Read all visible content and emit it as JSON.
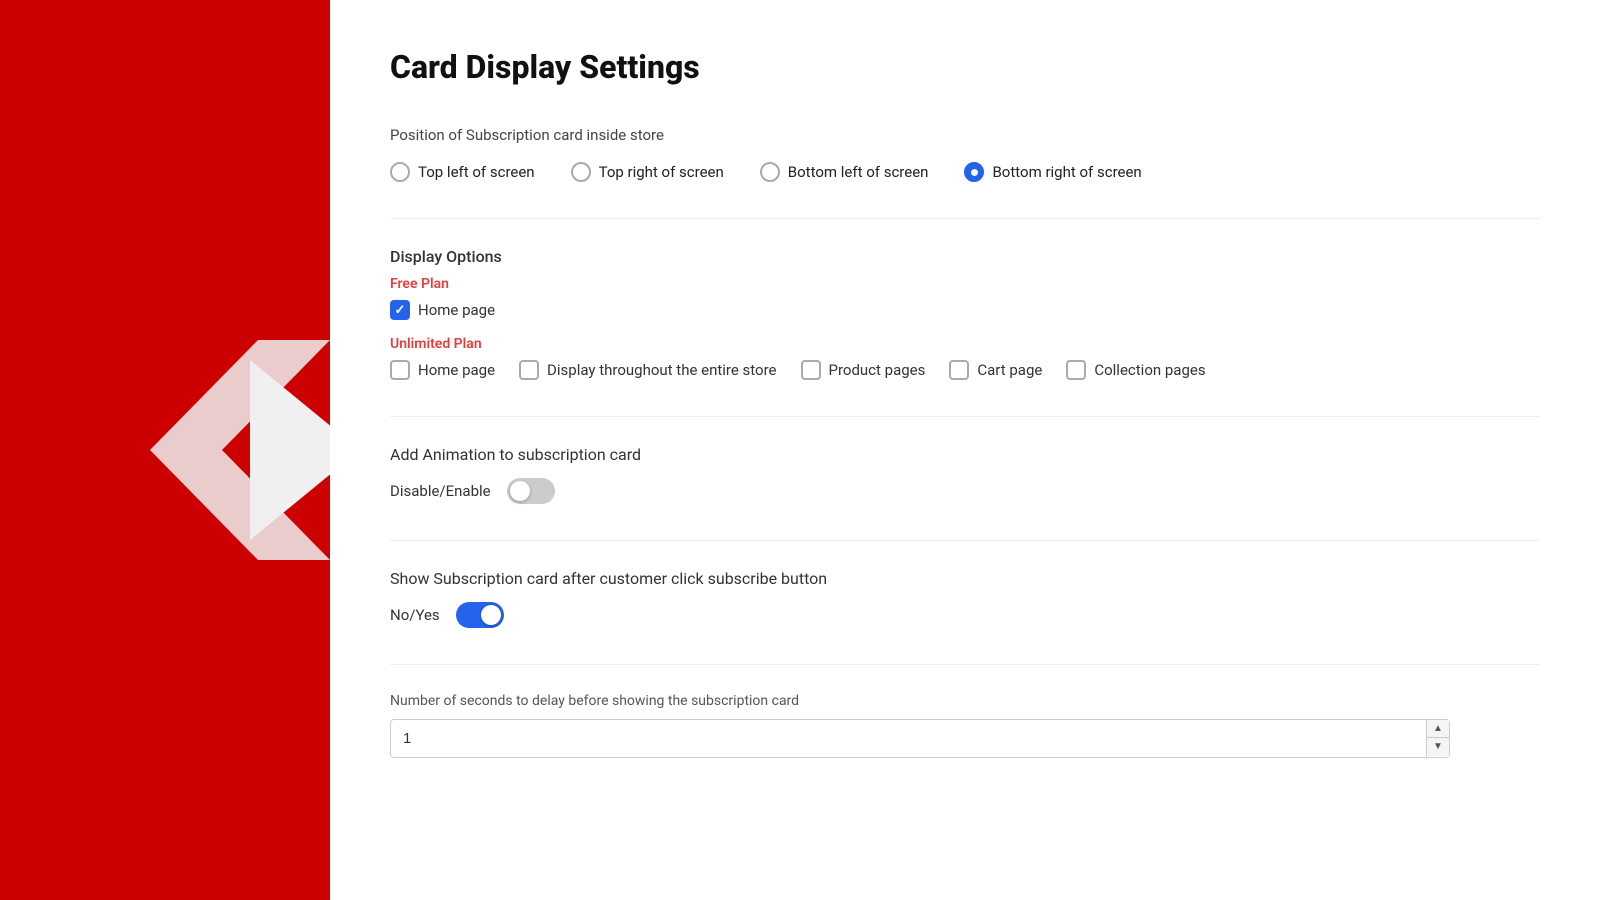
{
  "sidebar": {
    "background_color": "#cc0000"
  },
  "page": {
    "title": "Card Display Settings"
  },
  "position_section": {
    "label": "Position of Subscription card inside store",
    "options": [
      {
        "id": "top-left",
        "label": "Top left of screen",
        "checked": false
      },
      {
        "id": "top-right",
        "label": "Top right of screen",
        "checked": false
      },
      {
        "id": "bottom-left",
        "label": "Bottom left of screen",
        "checked": false
      },
      {
        "id": "bottom-right",
        "label": "Bottom right of screen",
        "checked": true
      }
    ]
  },
  "display_options": {
    "title": "Display Options",
    "free_plan": {
      "label": "Free Plan",
      "options": [
        {
          "id": "home-page-free",
          "label": "Home page",
          "checked": true
        }
      ]
    },
    "unlimited_plan": {
      "label": "Unlimited Plan",
      "options": [
        {
          "id": "home-page-unlimited",
          "label": "Home page",
          "checked": false
        },
        {
          "id": "entire-store",
          "label": "Display throughout the entire store",
          "checked": false
        },
        {
          "id": "product-pages",
          "label": "Product pages",
          "checked": false
        },
        {
          "id": "cart-page",
          "label": "Cart page",
          "checked": false
        },
        {
          "id": "collection-pages",
          "label": "Collection pages",
          "checked": false
        }
      ]
    }
  },
  "animation_section": {
    "title": "Add Animation to subscription card",
    "toggle_label": "Disable/Enable",
    "toggle_enabled": false
  },
  "show_after_subscribe": {
    "title": "Show Subscription card after customer click subscribe button",
    "toggle_label": "No/Yes",
    "toggle_enabled": true
  },
  "delay_section": {
    "label": "Number of seconds to delay before showing the subscription card",
    "value": "1",
    "spinner_up": "▲",
    "spinner_down": "▼"
  }
}
